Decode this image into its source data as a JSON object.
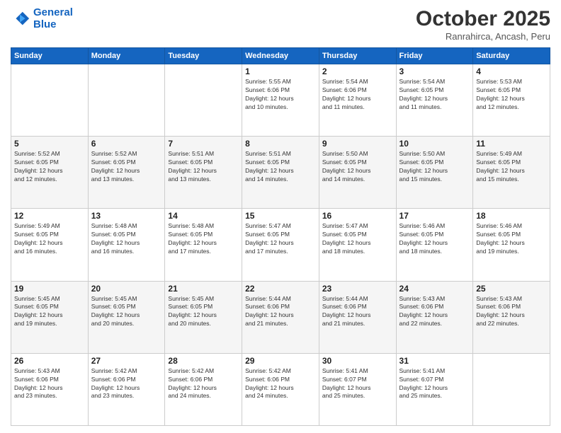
{
  "logo": {
    "line1": "General",
    "line2": "Blue"
  },
  "title": "October 2025",
  "subtitle": "Ranrahirca, Ancash, Peru",
  "weekdays": [
    "Sunday",
    "Monday",
    "Tuesday",
    "Wednesday",
    "Thursday",
    "Friday",
    "Saturday"
  ],
  "weeks": [
    [
      {
        "day": "",
        "info": ""
      },
      {
        "day": "",
        "info": ""
      },
      {
        "day": "",
        "info": ""
      },
      {
        "day": "1",
        "info": "Sunrise: 5:55 AM\nSunset: 6:06 PM\nDaylight: 12 hours\nand 10 minutes."
      },
      {
        "day": "2",
        "info": "Sunrise: 5:54 AM\nSunset: 6:06 PM\nDaylight: 12 hours\nand 11 minutes."
      },
      {
        "day": "3",
        "info": "Sunrise: 5:54 AM\nSunset: 6:05 PM\nDaylight: 12 hours\nand 11 minutes."
      },
      {
        "day": "4",
        "info": "Sunrise: 5:53 AM\nSunset: 6:05 PM\nDaylight: 12 hours\nand 12 minutes."
      }
    ],
    [
      {
        "day": "5",
        "info": "Sunrise: 5:52 AM\nSunset: 6:05 PM\nDaylight: 12 hours\nand 12 minutes."
      },
      {
        "day": "6",
        "info": "Sunrise: 5:52 AM\nSunset: 6:05 PM\nDaylight: 12 hours\nand 13 minutes."
      },
      {
        "day": "7",
        "info": "Sunrise: 5:51 AM\nSunset: 6:05 PM\nDaylight: 12 hours\nand 13 minutes."
      },
      {
        "day": "8",
        "info": "Sunrise: 5:51 AM\nSunset: 6:05 PM\nDaylight: 12 hours\nand 14 minutes."
      },
      {
        "day": "9",
        "info": "Sunrise: 5:50 AM\nSunset: 6:05 PM\nDaylight: 12 hours\nand 14 minutes."
      },
      {
        "day": "10",
        "info": "Sunrise: 5:50 AM\nSunset: 6:05 PM\nDaylight: 12 hours\nand 15 minutes."
      },
      {
        "day": "11",
        "info": "Sunrise: 5:49 AM\nSunset: 6:05 PM\nDaylight: 12 hours\nand 15 minutes."
      }
    ],
    [
      {
        "day": "12",
        "info": "Sunrise: 5:49 AM\nSunset: 6:05 PM\nDaylight: 12 hours\nand 16 minutes."
      },
      {
        "day": "13",
        "info": "Sunrise: 5:48 AM\nSunset: 6:05 PM\nDaylight: 12 hours\nand 16 minutes."
      },
      {
        "day": "14",
        "info": "Sunrise: 5:48 AM\nSunset: 6:05 PM\nDaylight: 12 hours\nand 17 minutes."
      },
      {
        "day": "15",
        "info": "Sunrise: 5:47 AM\nSunset: 6:05 PM\nDaylight: 12 hours\nand 17 minutes."
      },
      {
        "day": "16",
        "info": "Sunrise: 5:47 AM\nSunset: 6:05 PM\nDaylight: 12 hours\nand 18 minutes."
      },
      {
        "day": "17",
        "info": "Sunrise: 5:46 AM\nSunset: 6:05 PM\nDaylight: 12 hours\nand 18 minutes."
      },
      {
        "day": "18",
        "info": "Sunrise: 5:46 AM\nSunset: 6:05 PM\nDaylight: 12 hours\nand 19 minutes."
      }
    ],
    [
      {
        "day": "19",
        "info": "Sunrise: 5:45 AM\nSunset: 6:05 PM\nDaylight: 12 hours\nand 19 minutes."
      },
      {
        "day": "20",
        "info": "Sunrise: 5:45 AM\nSunset: 6:05 PM\nDaylight: 12 hours\nand 20 minutes."
      },
      {
        "day": "21",
        "info": "Sunrise: 5:45 AM\nSunset: 6:05 PM\nDaylight: 12 hours\nand 20 minutes."
      },
      {
        "day": "22",
        "info": "Sunrise: 5:44 AM\nSunset: 6:06 PM\nDaylight: 12 hours\nand 21 minutes."
      },
      {
        "day": "23",
        "info": "Sunrise: 5:44 AM\nSunset: 6:06 PM\nDaylight: 12 hours\nand 21 minutes."
      },
      {
        "day": "24",
        "info": "Sunrise: 5:43 AM\nSunset: 6:06 PM\nDaylight: 12 hours\nand 22 minutes."
      },
      {
        "day": "25",
        "info": "Sunrise: 5:43 AM\nSunset: 6:06 PM\nDaylight: 12 hours\nand 22 minutes."
      }
    ],
    [
      {
        "day": "26",
        "info": "Sunrise: 5:43 AM\nSunset: 6:06 PM\nDaylight: 12 hours\nand 23 minutes."
      },
      {
        "day": "27",
        "info": "Sunrise: 5:42 AM\nSunset: 6:06 PM\nDaylight: 12 hours\nand 23 minutes."
      },
      {
        "day": "28",
        "info": "Sunrise: 5:42 AM\nSunset: 6:06 PM\nDaylight: 12 hours\nand 24 minutes."
      },
      {
        "day": "29",
        "info": "Sunrise: 5:42 AM\nSunset: 6:06 PM\nDaylight: 12 hours\nand 24 minutes."
      },
      {
        "day": "30",
        "info": "Sunrise: 5:41 AM\nSunset: 6:07 PM\nDaylight: 12 hours\nand 25 minutes."
      },
      {
        "day": "31",
        "info": "Sunrise: 5:41 AM\nSunset: 6:07 PM\nDaylight: 12 hours\nand 25 minutes."
      },
      {
        "day": "",
        "info": ""
      }
    ]
  ]
}
